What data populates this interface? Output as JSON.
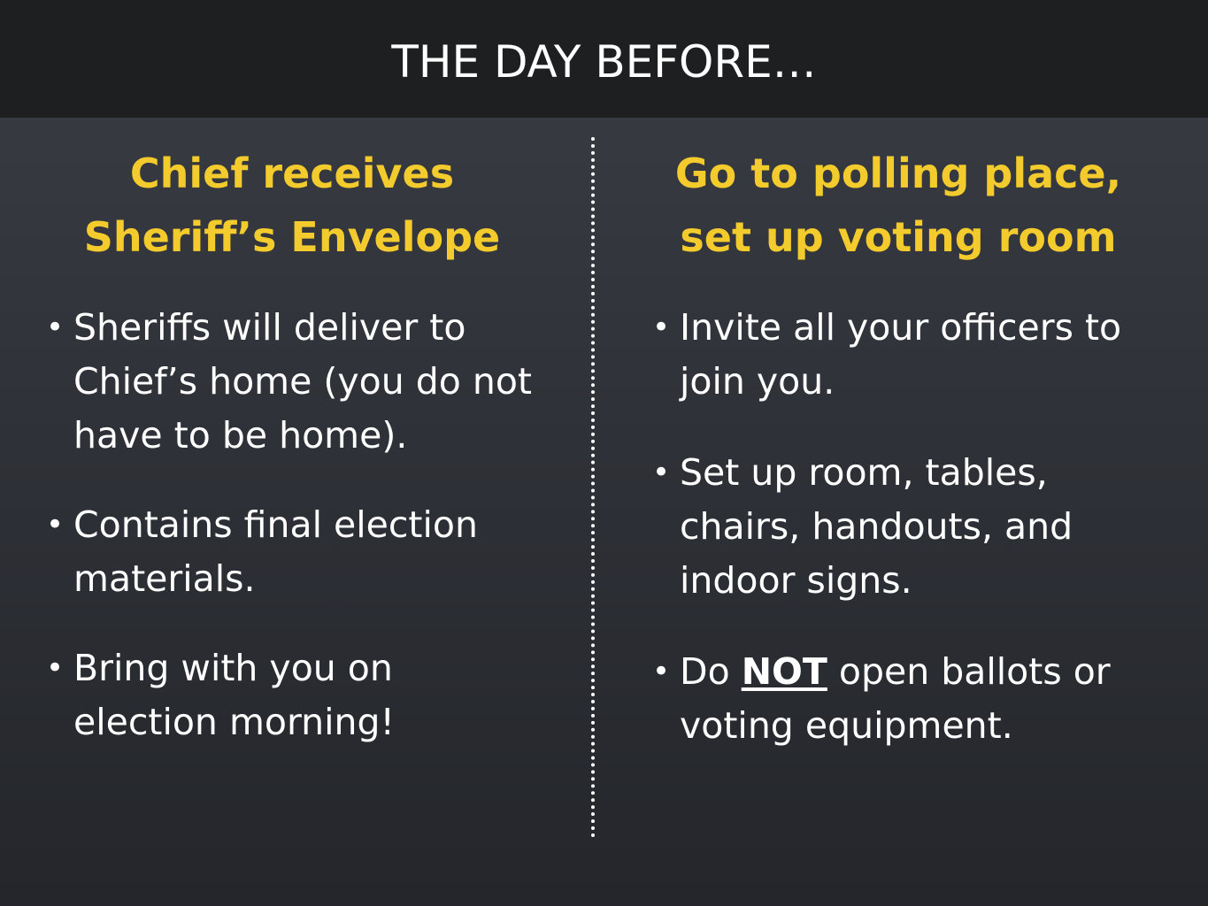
{
  "title": "THE DAY BEFORE…",
  "left_column": {
    "heading_line1": "Chief receives",
    "heading_line2": "Sheriff’s Envelope",
    "bullets": [
      {
        "line1": "Sheriffs will deliver to",
        "line2": "Chief’s home (you do not",
        "line3": "have to be home)."
      },
      {
        "line1": "Contains final election",
        "line2": "materials."
      },
      {
        "line1": "Bring with you on",
        "line2": "election morning!"
      }
    ]
  },
  "right_column": {
    "heading_line1": "Go to polling place,",
    "heading_line2": "set up voting room",
    "bullets": [
      {
        "line1": "Invite all your officers to",
        "line2": "join you."
      },
      {
        "line1": "Set up room, tables,",
        "line2": "chairs, handouts, and",
        "line3": "indoor signs."
      },
      {
        "prefix": "Do ",
        "emphasis": "NOT",
        "suffix": " open ballots or",
        "line2": "voting equipment."
      }
    ]
  },
  "colors": {
    "title_bar": "#1e1f21",
    "heading": "#f3cb2c",
    "text": "#ffffff"
  },
  "bullet_glyph": "•"
}
